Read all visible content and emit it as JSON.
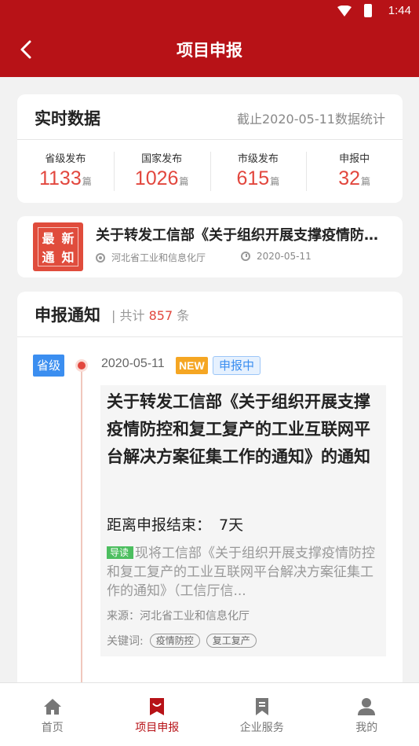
{
  "status_bar": {
    "time": "1:44"
  },
  "header": {
    "title": "项目申报"
  },
  "stats": {
    "title": "实时数据",
    "subtitle": "截止2020-05-11数据统计",
    "items": [
      {
        "label": "省级发布",
        "value": "1133",
        "unit": "篇"
      },
      {
        "label": "国家发布",
        "value": "1026",
        "unit": "篇"
      },
      {
        "label": "市级发布",
        "value": "615",
        "unit": "篇"
      },
      {
        "label": "申报中",
        "value": "32",
        "unit": "篇"
      }
    ]
  },
  "latest_news": {
    "badge": [
      "最",
      "新",
      "通",
      "知"
    ],
    "title": "关于转发工信部《关于组织开展支撑疫情防控和复工复产的工业互联网平台解决方案征集工作的通知》的通知",
    "source": "河北省工业和信息化厅",
    "date": "2020-05-11"
  },
  "notices": {
    "title": "申报通知",
    "count_prefix": "| 共计",
    "count": "857",
    "count_suffix": "条",
    "item": {
      "level": "省级",
      "date": "2020-05-11",
      "new_label": "NEW",
      "status": "申报中",
      "title": "关于转发工信部《关于组织开展支撑疫情防控和复工复产的工业互联网平台解决方案征集工作的通知》的通知",
      "deadline_label": "距离申报结束：",
      "deadline_value": "7天",
      "guide_label": "导读",
      "summary": "现将工信部《关于组织开展支撑疫情防控和复工复产的工业互联网平台解决方案征集工作的通知》（工信厅信...",
      "source": "来源：河北省工业和信息化厅",
      "keywords_label": "关键词:",
      "keywords": [
        "疫情防控",
        "复工复产"
      ]
    }
  },
  "tabbar": {
    "items": [
      {
        "label": "首页",
        "icon": "home-icon"
      },
      {
        "label": "项目申报",
        "icon": "project-icon",
        "active": true
      },
      {
        "label": "企业服务",
        "icon": "bookmark-icon"
      },
      {
        "label": "我的",
        "icon": "user-icon"
      }
    ]
  },
  "colors": {
    "brand": "#b71217",
    "accent": "#e2473e",
    "blue": "#3b8ef0"
  }
}
